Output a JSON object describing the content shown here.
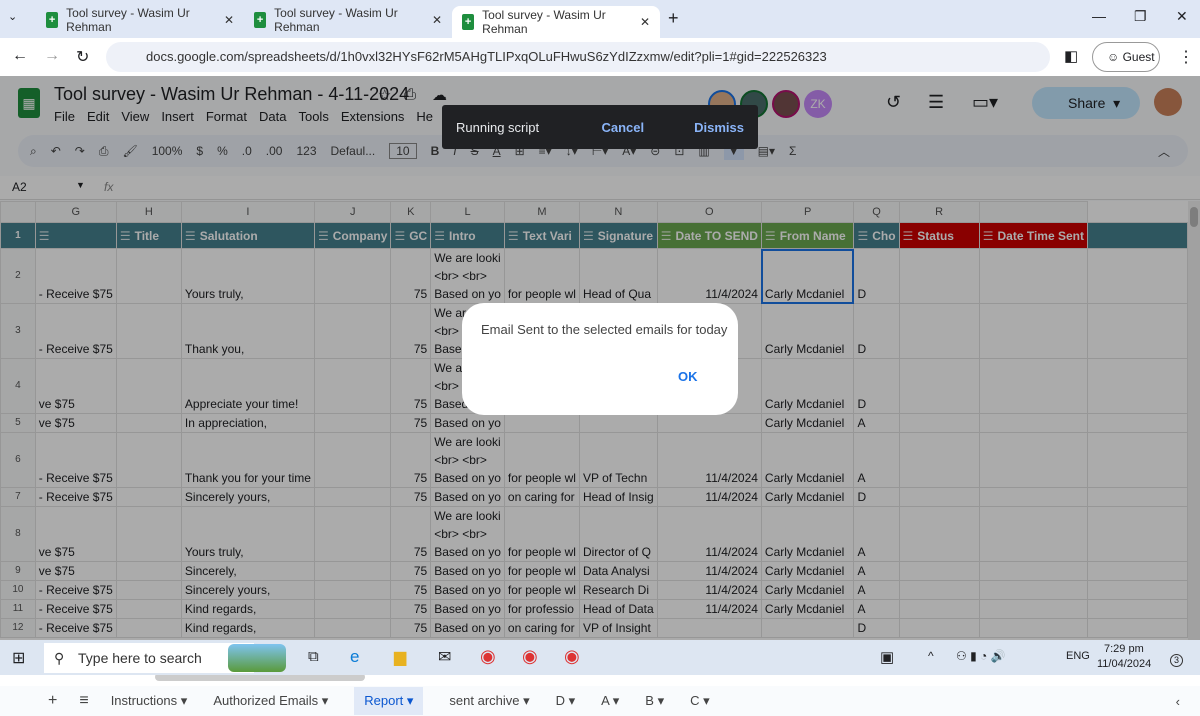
{
  "browser": {
    "tabs": [
      "Tool survey - Wasim Ur Rehman",
      "Tool survey - Wasim Ur Rehman",
      "Tool survey - Wasim Ur Rehman"
    ],
    "url": "docs.google.com/spreadsheets/d/1h0vxl32HYsF62rM5AHgTLIPxqOLuFHwuS6zYdIZzxmw/edit?pli=1#gid=222526323",
    "profile": "Guest"
  },
  "doc": {
    "title": "Tool survey - Wasim Ur Rehman - 4-11-2024",
    "menu": [
      "File",
      "Edit",
      "View",
      "Insert",
      "Format",
      "Data",
      "Tools",
      "Extensions",
      "He"
    ],
    "share": "Share",
    "collab_initials": "ZK"
  },
  "toolbar": {
    "zoom": "100%",
    "currency": "$",
    "percent": "%",
    "dec_minus": ".0",
    "dec_plus": ".00",
    "format_123": "123",
    "font": "Defaul...",
    "font_size": "10"
  },
  "formula": {
    "cell_ref": "A2",
    "fx": "fx"
  },
  "toast": {
    "text": "Running script",
    "cancel": "Cancel",
    "dismiss": "Dismiss"
  },
  "dialog": {
    "message": "Email Sent to the selected emails for today",
    "ok": "OK"
  },
  "grid": {
    "col_letters": [
      "",
      "G",
      "H",
      "I",
      "J",
      "K",
      "L",
      "M",
      "N",
      "O",
      "P",
      "Q",
      "R",
      ""
    ],
    "headers": [
      "",
      "Title",
      "Salutation",
      "Company",
      "GC",
      "Intro",
      "Text Vari",
      "Signature",
      "Date TO SEND",
      "From Name",
      "Cho",
      "Status",
      "Date Time Sent"
    ],
    "rows": [
      {
        "n": "2",
        "f": "- Receive $75",
        "h": "Yours truly,",
        "j": "75",
        "k": [
          "We are looki",
          "<br> <br>",
          "Based on yo"
        ],
        "l": "for people wl",
        "m": "Head of Qua",
        "nd": "11/4/2024",
        "o": "Carly Mcdaniel",
        "p": "D"
      },
      {
        "n": "3",
        "f": "- Receive $75",
        "h": "Thank you,",
        "j": "75",
        "k": [
          "We are looki",
          "<br> <br>",
          "Based on yo"
        ],
        "l": "",
        "m": "",
        "nd": "",
        "o": "Carly Mcdaniel",
        "p": "D"
      },
      {
        "n": "4",
        "f": "ve $75",
        "h": "Appreciate your time!",
        "j": "75",
        "k": [
          "We are looki",
          "<br> <br>",
          "Based on yo"
        ],
        "l": "",
        "m": "",
        "nd": "",
        "o": "Carly Mcdaniel",
        "p": "D"
      },
      {
        "n": "5",
        "f": "ve $75",
        "h": "In appreciation,",
        "j": "75",
        "k": [
          "Based on yo"
        ],
        "l": "",
        "m": "",
        "nd": "",
        "o": "Carly Mcdaniel",
        "p": "A"
      },
      {
        "n": "6",
        "f": "- Receive $75",
        "h": "Thank you for your time",
        "j": "75",
        "k": [
          "We are looki",
          "<br> <br>",
          "Based on yo"
        ],
        "l": "for people wl",
        "m": "VP of Techn",
        "nd": "11/4/2024",
        "o": "Carly Mcdaniel",
        "p": "A"
      },
      {
        "n": "7",
        "f": "- Receive $75",
        "h": "Sincerely yours,",
        "j": "75",
        "k": [
          "Based on yo"
        ],
        "l": "on caring for",
        "m": "Head of Insig",
        "nd": "11/4/2024",
        "o": "Carly Mcdaniel",
        "p": "D"
      },
      {
        "n": "8",
        "f": "ve $75",
        "h": "Yours truly,",
        "j": "75",
        "k": [
          "We are looki",
          "<br> <br>",
          "Based on yo"
        ],
        "l": "for people wl",
        "m": "Director of Q",
        "nd": "11/4/2024",
        "o": "Carly Mcdaniel",
        "p": "A"
      },
      {
        "n": "9",
        "f": "ve $75",
        "h": "Sincerely,",
        "j": "75",
        "k": [
          "Based on yo"
        ],
        "l": "for people wl",
        "m": "Data Analysi",
        "nd": "11/4/2024",
        "o": "Carly Mcdaniel",
        "p": "A"
      },
      {
        "n": "10",
        "f": "- Receive $75",
        "h": "Sincerely yours,",
        "j": "75",
        "k": [
          "Based on yo"
        ],
        "l": "for people wl",
        "m": "Research Di",
        "nd": "11/4/2024",
        "o": "Carly Mcdaniel",
        "p": "A"
      },
      {
        "n": "11",
        "f": "- Receive $75",
        "h": "Kind regards,",
        "j": "75",
        "k": [
          "Based on yo"
        ],
        "l": "for professio",
        "m": "Head of Data",
        "nd": "11/4/2024",
        "o": "Carly Mcdaniel",
        "p": "A"
      },
      {
        "n": "12",
        "f": "- Receive $75",
        "h": "Kind regards,",
        "j": "75",
        "k": [
          "Based on yo"
        ],
        "l": "on caring for",
        "m": "VP of Insight",
        "nd": "",
        "o": "",
        "p": "D"
      }
    ]
  },
  "sheet_tabs": [
    "Instructions",
    "Authorized Emails",
    "Report",
    "sent archive",
    "D",
    "A",
    "B",
    "C"
  ],
  "active_sheet": "Report",
  "taskbar": {
    "search_placeholder": "Type here to search",
    "lang": "ENG",
    "time": "7:29 pm",
    "date": "11/04/2024",
    "notifications": "3"
  }
}
